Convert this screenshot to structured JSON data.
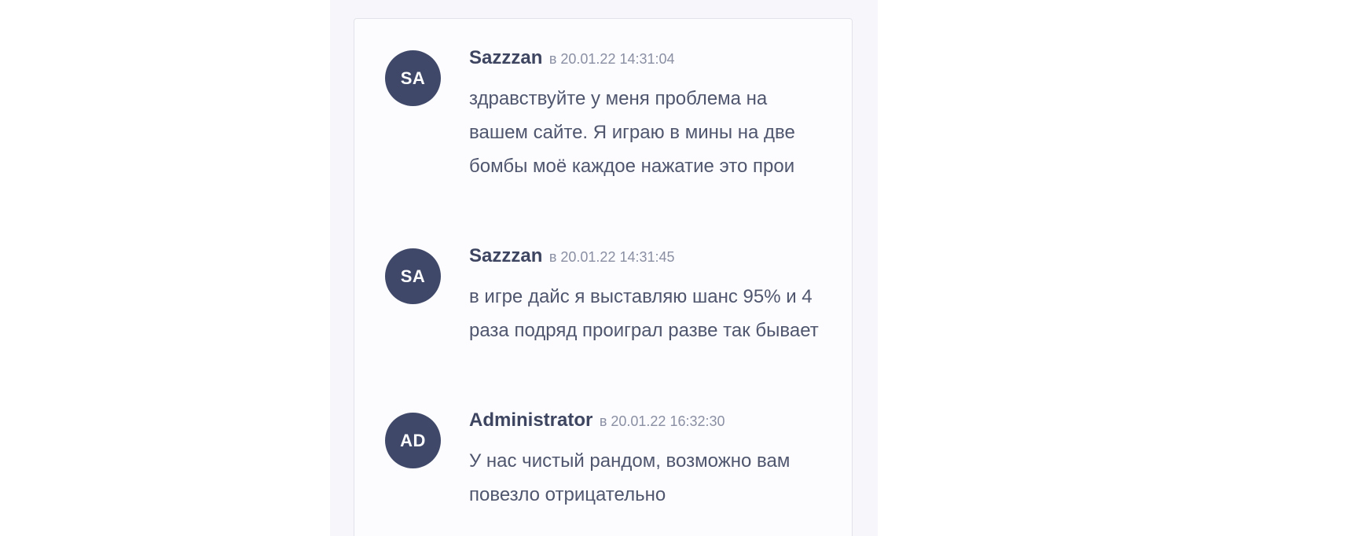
{
  "comments": [
    {
      "initials": "SA",
      "author": "Sazzzan",
      "meta": "в 20.01.22 14:31:04",
      "text": "здравствуйте у меня проблема на вашем сайте. Я играю в мины на две бомбы моё каждое нажатие это прои"
    },
    {
      "initials": "SA",
      "author": "Sazzzan",
      "meta": "в 20.01.22 14:31:45",
      "text": "в игре дайс я выставляю шанс 95% и 4 раза подряд проиграл разве так бывает"
    },
    {
      "initials": "AD",
      "author": "Administrator",
      "meta": "в 20.01.22 16:32:30",
      "text": "У нас чистый рандом, возможно вам повезло отрицательно"
    }
  ],
  "colors": {
    "avatar_bg": "#3f4868",
    "author": "#3d4560",
    "meta": "#8a8fa3",
    "text": "#4f566e"
  }
}
